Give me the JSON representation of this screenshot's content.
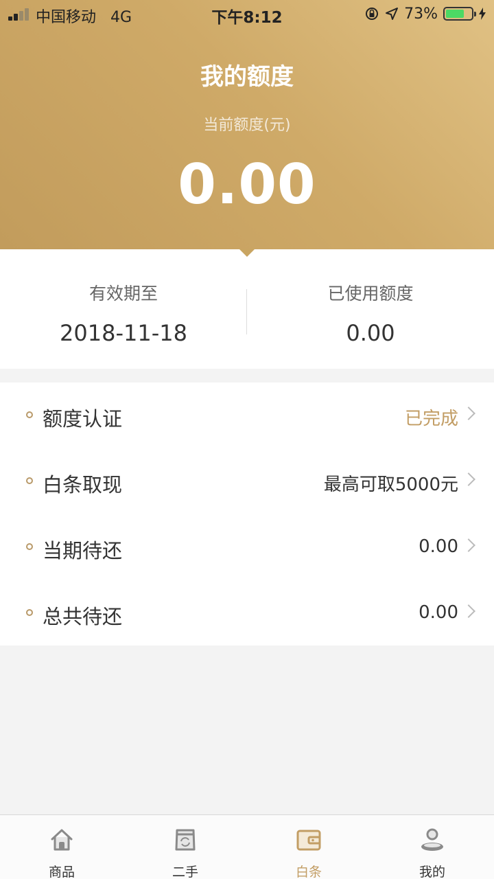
{
  "status_bar": {
    "carrier": "中国移动",
    "network": "4G",
    "time": "下午8:12",
    "battery_percent": "73%",
    "battery_level": 0.73
  },
  "header": {
    "title": "我的额度",
    "current_label": "当前额度(元)",
    "current_value": "0.00"
  },
  "info": {
    "valid_until_label": "有效期至",
    "valid_until_value": "2018-11-18",
    "used_label": "已使用额度",
    "used_value": "0.00"
  },
  "list": {
    "items": [
      {
        "title": "额度认证",
        "value": "已完成"
      },
      {
        "title": "白条取现",
        "value": "最高可取5000元"
      },
      {
        "title": "当期待还",
        "value": "0.00"
      },
      {
        "title": "总共待还",
        "value": "0.00"
      }
    ]
  },
  "tabbar": {
    "items": [
      {
        "label": "商品",
        "icon": "home-icon"
      },
      {
        "label": "二手",
        "icon": "secondhand-icon"
      },
      {
        "label": "白条",
        "icon": "wallet-icon"
      },
      {
        "label": "我的",
        "icon": "profile-icon"
      }
    ],
    "active_index": 2
  },
  "colors": {
    "accent": "#c29d64",
    "hero_gradient_start": "#e0c184",
    "hero_gradient_end": "#c29c5c"
  }
}
